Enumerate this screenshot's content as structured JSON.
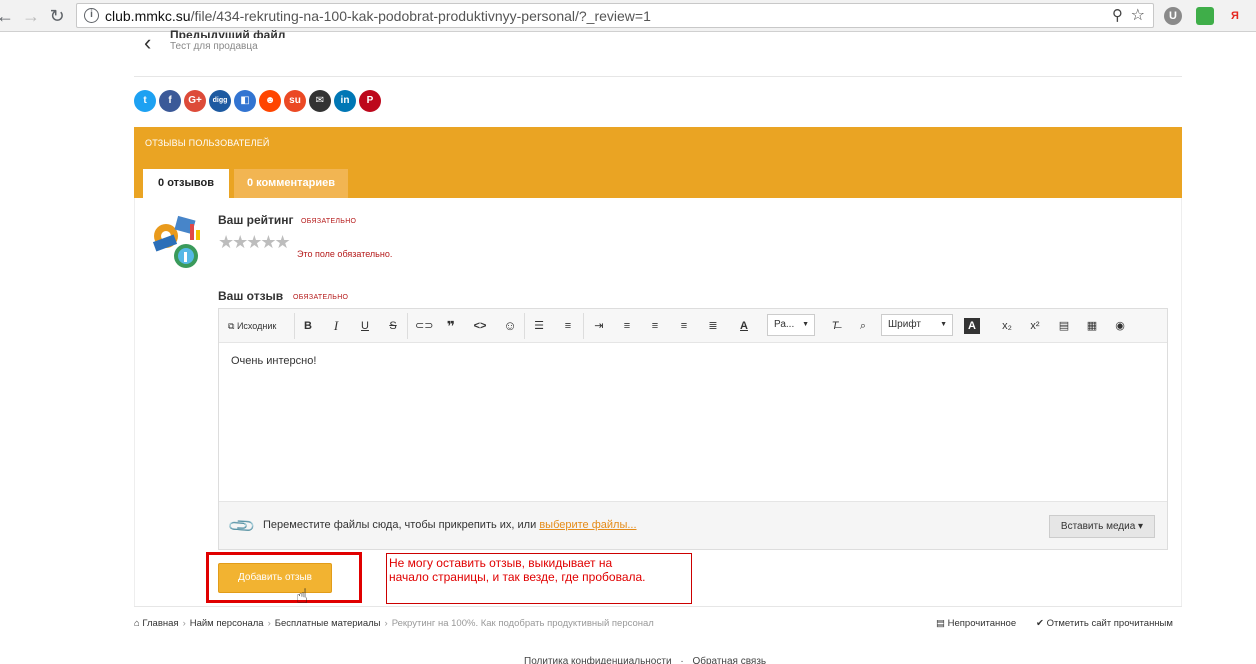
{
  "browser": {
    "url_host": "club.mmkc.su",
    "url_path": "/file/434-rekruting-na-100-kak-podobrat-produktivnyy-personal/?_review=1",
    "extensions": [
      "U",
      "Я"
    ]
  },
  "back_link": {
    "title": "Предыдущий файл",
    "subtitle": "Тест для продавца"
  },
  "share_icons": [
    {
      "name": "twitter-icon",
      "glyph": "t",
      "color": "#1da1f2"
    },
    {
      "name": "facebook-icon",
      "glyph": "f",
      "color": "#3b5998"
    },
    {
      "name": "google-plus-icon",
      "glyph": "G+",
      "color": "#dd4b39"
    },
    {
      "name": "digg-icon",
      "glyph": "digg",
      "color": "#1d5aa1"
    },
    {
      "name": "delicious-icon",
      "glyph": "◧",
      "color": "#3274d1"
    },
    {
      "name": "reddit-icon",
      "glyph": "☻",
      "color": "#ff4500"
    },
    {
      "name": "stumbleupon-icon",
      "glyph": "su",
      "color": "#eb4924"
    },
    {
      "name": "email-icon",
      "glyph": "✉",
      "color": "#333333"
    },
    {
      "name": "linkedin-icon",
      "glyph": "in",
      "color": "#0077b5"
    },
    {
      "name": "pinterest-icon",
      "glyph": "P",
      "color": "#bd081c"
    }
  ],
  "reviews": {
    "title": "Отзывы пользователей",
    "tabs": [
      {
        "label": "0 отзывов",
        "active": true
      },
      {
        "label": "0 комментариев",
        "active": false
      }
    ]
  },
  "form": {
    "rating_label": "Ваш рейтинг",
    "required_label": "Обязательно",
    "stars": "★★★★★",
    "rating_error": "Это поле обязательно.",
    "review_label": "Ваш отзыв",
    "review_required": "Обязательно",
    "toolbar": {
      "source_label": "Исходник",
      "size_select": "Ра...",
      "font_select": "Шрифт"
    },
    "review_text": "Очень интерсно!",
    "attach_text": "Переместите файлы сюда, чтобы прикрепить их, или ",
    "attach_link": "выберите файлы...",
    "insert_media": "Вставить медиа ▾",
    "submit_label": "Добавить отзыв"
  },
  "annotation": {
    "line1": "Не могу оставить отзыв, выкидывает на",
    "line2": "начало страницы, и так везде, где пробовала."
  },
  "breadcrumbs": {
    "home": "Главная",
    "items": [
      "Найм персонала",
      "Бесплатные материалы"
    ],
    "current": "Рекрутинг на 100%. Как подобрать продуктивный персонал",
    "unread": "Непрочитанное",
    "mark_read": "Отметить сайт прочитанным"
  },
  "footer": {
    "privacy": "Политика конфиденциальности",
    "feedback": "Обратная связь"
  },
  "colors": {
    "accent": "#eaa423",
    "error": "#b51a1a",
    "annotation_red": "#e00000"
  }
}
